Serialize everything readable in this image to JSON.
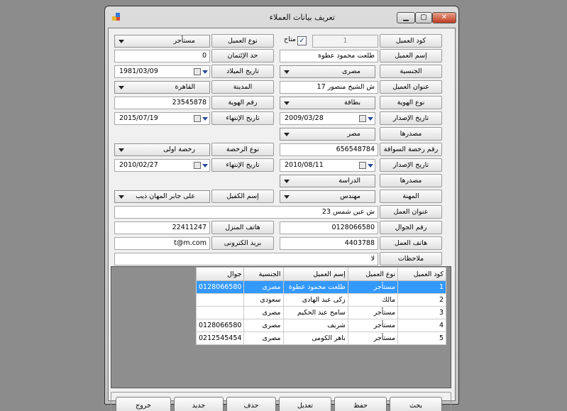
{
  "window": {
    "title": "تعريف بيانات العملاء"
  },
  "form": {
    "customer_code": {
      "label": "كود العميل",
      "value": "1"
    },
    "available": {
      "label": "متاح",
      "checked": true
    },
    "customer_type": {
      "label": "نوع العميل",
      "value": "مستأجر"
    },
    "customer_name": {
      "label": "إسم العميل",
      "value": "طلعت محمود عطوة"
    },
    "credit_limit": {
      "label": "حد الإئتمان",
      "value": "0"
    },
    "nationality": {
      "label": "الجنسية",
      "value": "مصرى"
    },
    "birth_date": {
      "label": "تاريخ الميلاد",
      "value": "1981/03/09"
    },
    "address": {
      "label": "عنوان العميل",
      "value": "17 ش الشيخ منصور"
    },
    "city": {
      "label": "المدينة",
      "value": "القاهرة"
    },
    "id_type": {
      "label": "نوع الهوية",
      "value": "بطاقة"
    },
    "id_number": {
      "label": "رقم الهوية",
      "value": "23545878"
    },
    "issue_date": {
      "label": "تاريخ الإصدار",
      "value": "2009/03/28"
    },
    "id_expiry": {
      "label": "تاريخ الإنتهاء",
      "value": "2015/07/19"
    },
    "id_source": {
      "label": "مصدرها",
      "value": "مصر"
    },
    "license_number": {
      "label": "رقم رخصة السواقة",
      "value": "656548784"
    },
    "license_type": {
      "label": "نوع الرخصة",
      "value": "رخصة اولى"
    },
    "license_issue": {
      "label": "تاريخ الإصدار",
      "value": "2010/08/11"
    },
    "license_expiry": {
      "label": "تاريخ الإنتهاء",
      "value": "2010/02/27"
    },
    "license_source": {
      "label": "مصدرها",
      "value": "الدراسة"
    },
    "job": {
      "label": "المهنة",
      "value": "مهندس"
    },
    "guarantor": {
      "label": "إسم الكفيل",
      "value": "على جابر المهان ذيب"
    },
    "work_address": {
      "label": "عنوان العمل",
      "value": "23 ش عين شمس"
    },
    "mobile": {
      "label": "رقم الجوال",
      "value": "0128066580"
    },
    "home_phone": {
      "label": "هاتف المنزل",
      "value": "22411247"
    },
    "work_phone": {
      "label": "هاتف العمل",
      "value": "4403788"
    },
    "email": {
      "label": "بريد الكترونى",
      "value": "t@m.com"
    },
    "notes": {
      "label": "ملاحظات",
      "value": "لا"
    }
  },
  "grid": {
    "headers": [
      "كود العميل",
      "نوع العميل",
      "إسم العميل",
      "الجنسية",
      "جوال"
    ],
    "rows": [
      [
        "1",
        "مستأجر",
        "طلعت محمود عطوة",
        "مصرى",
        "0128066580"
      ],
      [
        "2",
        "مالك",
        "زكى عبد الهادى",
        "سعودى",
        ""
      ],
      [
        "3",
        "مستأجر",
        "سامح عبد الحكيم",
        "مصرى",
        ""
      ],
      [
        "4",
        "مستأجر",
        "شريف",
        "مصرى",
        "0128066580"
      ],
      [
        "5",
        "مستأجر",
        "باهر الكومى",
        "مصرى",
        "0212545454"
      ]
    ]
  },
  "buttons": {
    "search": "بحث",
    "save": "حفظ",
    "edit": "تعديل",
    "delete": "حذف",
    "new": "جديد",
    "exit": "خروج"
  },
  "colors": {
    "selection": "#3399ff",
    "background": "#8c8c8c",
    "form": "#f0f0f0"
  }
}
